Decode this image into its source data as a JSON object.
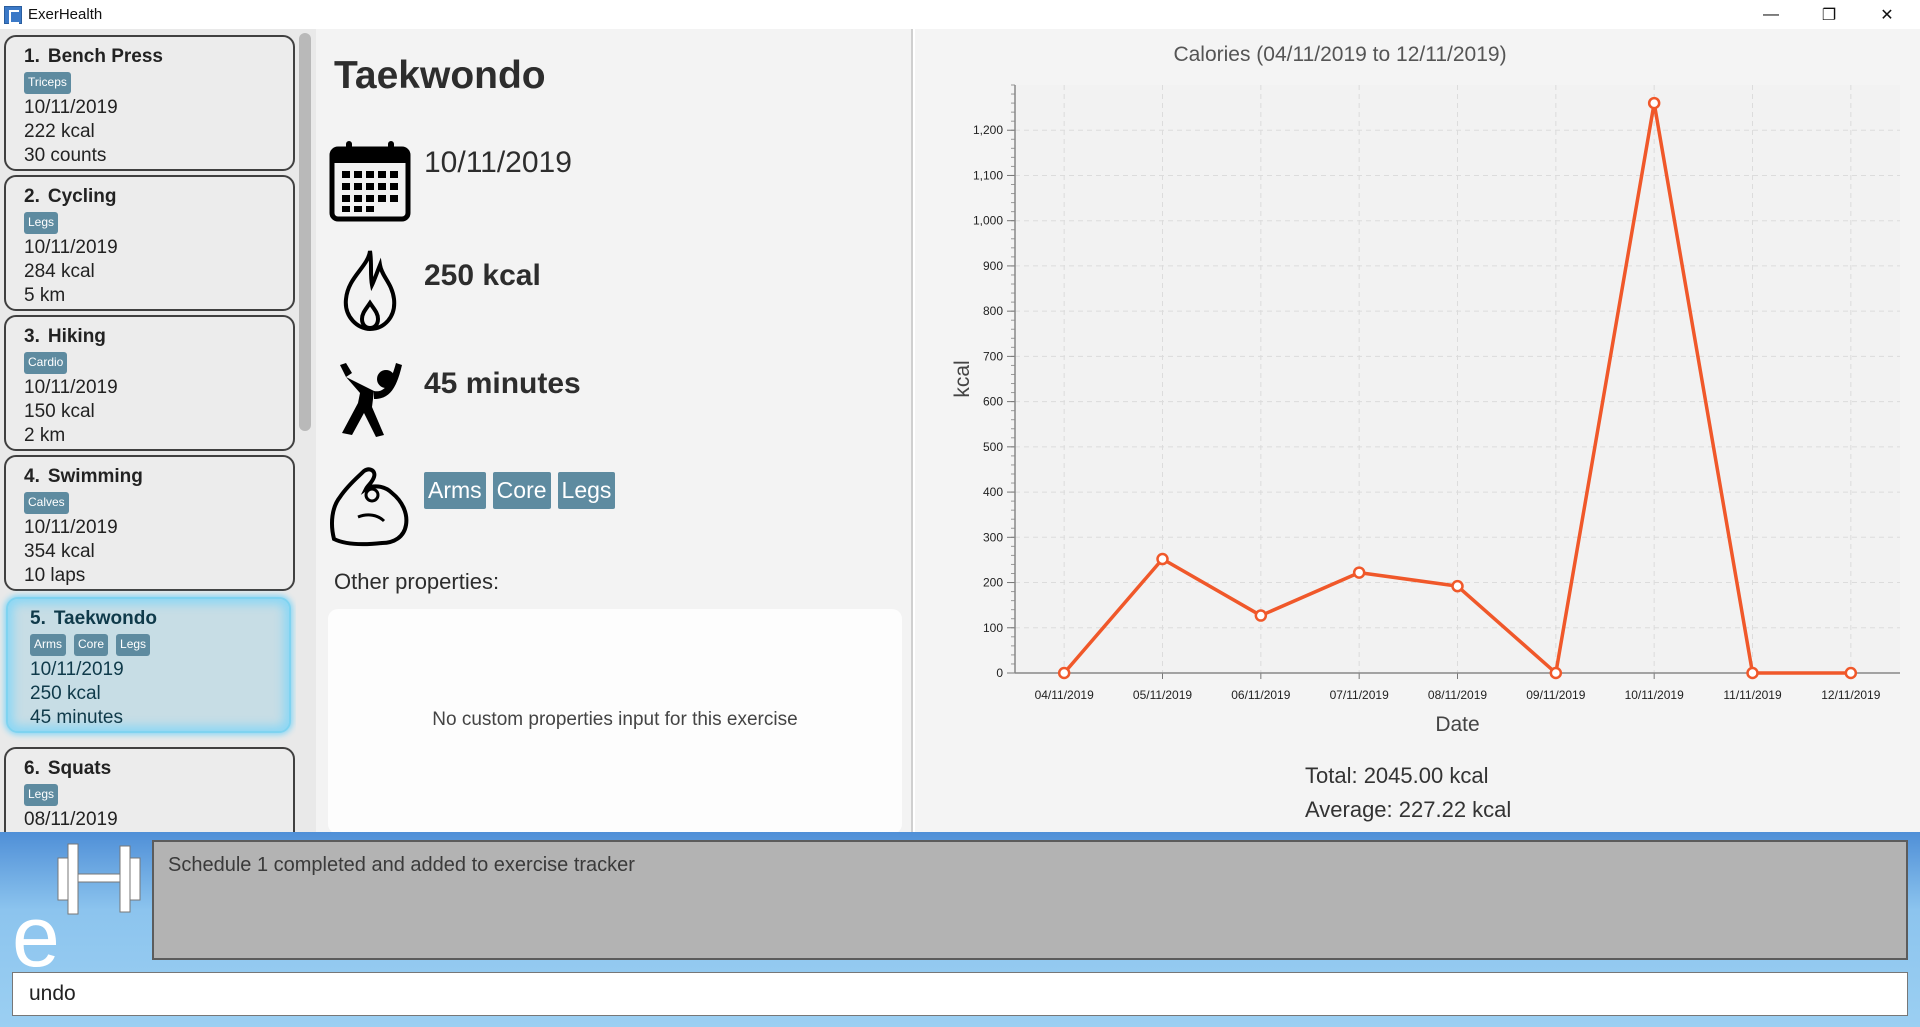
{
  "window": {
    "title": "ExerHealth",
    "minimize": "—",
    "restore": "❐",
    "close": "✕"
  },
  "exercise_list": [
    {
      "index": "1.",
      "name": "Bench Press",
      "tags": [
        "Triceps"
      ],
      "date": "10/11/2019",
      "calories": "222 kcal",
      "quantity": "30 counts"
    },
    {
      "index": "2.",
      "name": "Cycling",
      "tags": [
        "Legs"
      ],
      "date": "10/11/2019",
      "calories": "284 kcal",
      "quantity": "5 km"
    },
    {
      "index": "3.",
      "name": "Hiking",
      "tags": [
        "Cardio"
      ],
      "date": "10/11/2019",
      "calories": "150 kcal",
      "quantity": "2 km"
    },
    {
      "index": "4.",
      "name": "Swimming",
      "tags": [
        "Calves"
      ],
      "date": "10/11/2019",
      "calories": "354 kcal",
      "quantity": "10 laps"
    },
    {
      "index": "5.",
      "name": "Taekwondo",
      "tags": [
        "Arms",
        "Core",
        "Legs"
      ],
      "date": "10/11/2019",
      "calories": "250 kcal",
      "quantity": "45 minutes"
    },
    {
      "index": "6.",
      "name": "Squats",
      "tags": [
        "Legs"
      ],
      "date": "08/11/2019",
      "calories": "",
      "quantity": ""
    }
  ],
  "detail": {
    "title": "Taekwondo",
    "date": "10/11/2019",
    "calories": "250 kcal",
    "quantity": "45 minutes",
    "muscles": [
      "Arms",
      "Core",
      "Legs"
    ],
    "other_label": "Other properties:",
    "no_props_message": "No custom properties input for this exercise"
  },
  "chart_data": {
    "type": "line",
    "title": "Calories (04/11/2019 to 12/11/2019)",
    "xlabel": "Date",
    "ylabel": "kcal",
    "categories": [
      "04/11/2019",
      "05/11/2019",
      "06/11/2019",
      "07/11/2019",
      "08/11/2019",
      "09/11/2019",
      "10/11/2019",
      "11/11/2019",
      "12/11/2019"
    ],
    "values": [
      0,
      252,
      127,
      222,
      192,
      0,
      1260,
      0,
      0
    ],
    "ylim": [
      0,
      1300
    ],
    "yticks": [
      0,
      100,
      200,
      300,
      400,
      500,
      600,
      700,
      800,
      900,
      1000,
      1100,
      1200
    ],
    "ytick_labels": [
      "0",
      "100",
      "200",
      "300",
      "400",
      "500",
      "600",
      "700",
      "800",
      "900",
      "1,000",
      "1,100",
      "1,200"
    ],
    "color": "#f0582a",
    "grid": true
  },
  "summary": {
    "total": "Total: 2045.00 kcal",
    "average": "Average: 227.22 kcal"
  },
  "result": {
    "message": "Schedule 1 completed and added to exercise tracker"
  },
  "command": {
    "value": "undo"
  },
  "colors": {
    "tag": "#5e8ba0",
    "selected_card": "#c7dde5",
    "line": "#f0582a"
  }
}
